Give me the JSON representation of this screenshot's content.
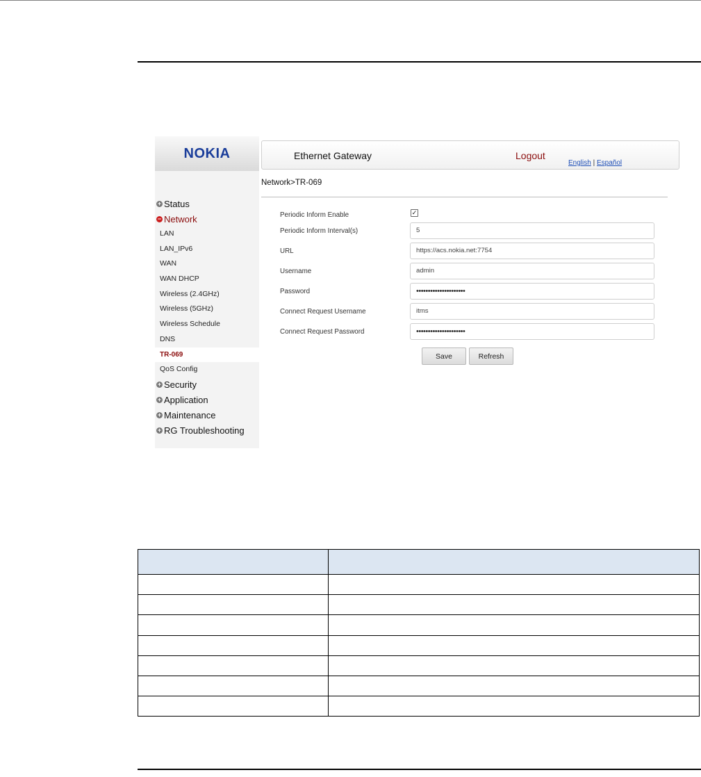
{
  "router": {
    "brand": "NOKIA",
    "header": {
      "title": "Ethernet Gateway",
      "logout": "Logout",
      "lang_english": "English",
      "lang_separator": "|",
      "lang_espanol": "Español"
    },
    "breadcrumb": "Network>TR-069",
    "nav": {
      "status": "Status",
      "network": "Network",
      "network_items": [
        "LAN",
        "LAN_IPv6",
        "WAN",
        "WAN DHCP",
        "Wireless (2.4GHz)",
        "Wireless (5GHz)",
        "Wireless Schedule",
        "DNS",
        "TR-069",
        "QoS Config"
      ],
      "security": "Security",
      "application": "Application",
      "maintenance": "Maintenance",
      "rg_troubleshooting": "RG Troubleshooting"
    },
    "form": {
      "periodic_inform_enable": {
        "label": "Periodic Inform Enable",
        "checked": true
      },
      "periodic_inform_interval": {
        "label": "Periodic Inform Interval(s)",
        "value": "5"
      },
      "url": {
        "label": "URL",
        "value": "https://acs.nokia.net:7754"
      },
      "username": {
        "label": "Username",
        "value": "admin"
      },
      "password": {
        "label": "Password",
        "value": "•••••••••••••••••••••"
      },
      "cr_username": {
        "label": "Connect Request Username",
        "value": "itms"
      },
      "cr_password": {
        "label": "Connect Request Password",
        "value": "•••••••••••••••••••••"
      }
    },
    "buttons": {
      "save": "Save",
      "refresh": "Refresh"
    }
  },
  "doc_table": {
    "headers": [
      "",
      ""
    ],
    "rows": [
      [
        "",
        ""
      ],
      [
        "",
        ""
      ],
      [
        "",
        ""
      ],
      [
        "",
        ""
      ],
      [
        "",
        ""
      ],
      [
        "",
        ""
      ],
      [
        "",
        ""
      ]
    ]
  }
}
